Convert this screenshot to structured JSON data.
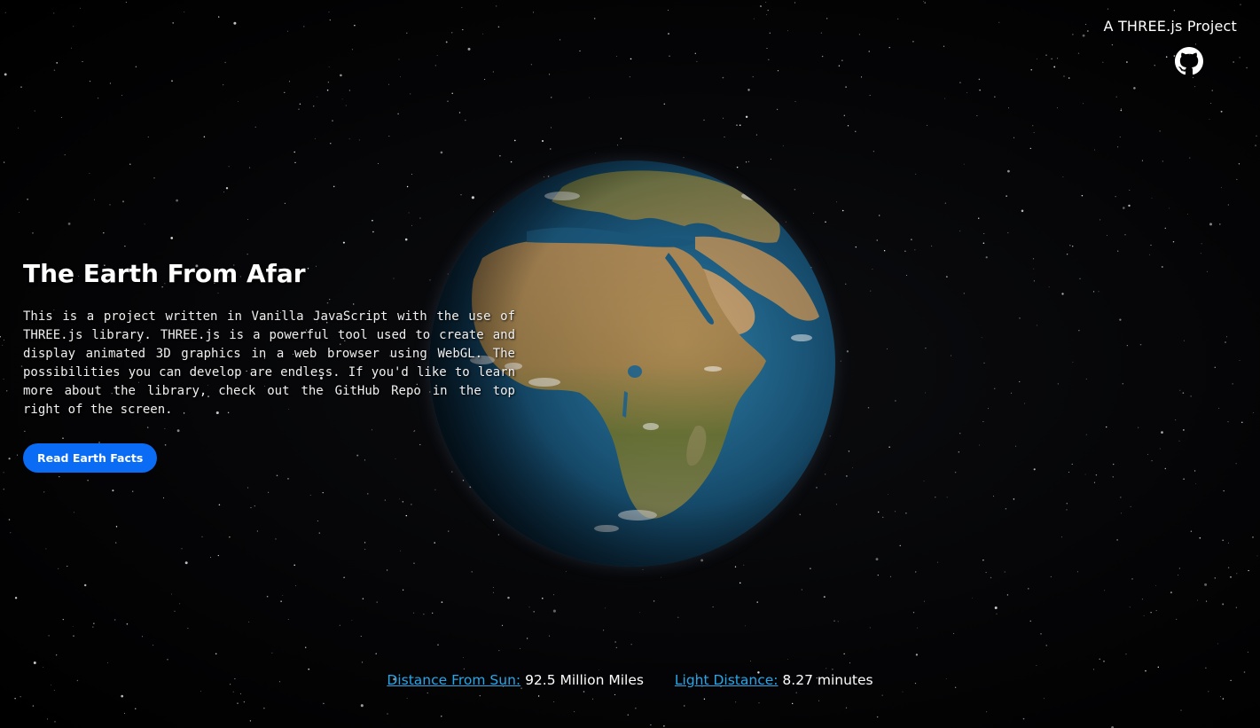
{
  "header": {
    "project_tag": "A THREE.js Project",
    "github_icon": "github-icon"
  },
  "hero": {
    "title": "The Earth From Afar",
    "description": "This is a project written in Vanilla JavaScript with the use of THREE.js library. THREE.js is a powerful tool used to create and display animated 3D graphics in a web browser using WebGL. The possibilities you can develop are endless. If you'd like to learn more about the library, check out the GitHub Repo in the top right of the screen.",
    "button_label": "Read Earth Facts"
  },
  "stats": {
    "distance_label": "Distance From Sun:",
    "distance_value": "92.5 Million Miles",
    "light_label": "Light Distance:",
    "light_value": "8.27 minutes"
  },
  "colors": {
    "background": "#000000",
    "accent_button": "#0a6cf5",
    "link": "#27a7e8",
    "ocean": "#1d5f86",
    "land": "#a88a5a"
  }
}
